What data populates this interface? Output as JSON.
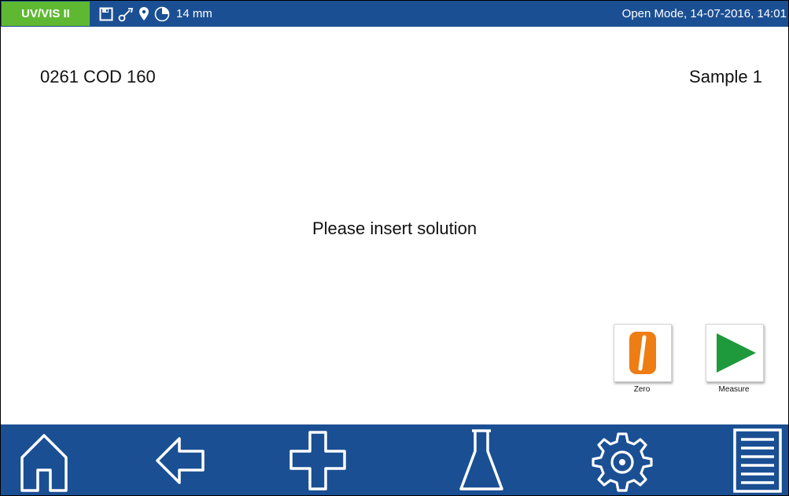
{
  "status_bar": {
    "device": "UV/VIS II",
    "cuvette": "14 mm",
    "mode_datetime": "Open Mode, 14-07-2016, 14:01",
    "icons": [
      "save-icon",
      "wrench-icon",
      "location-pin-icon",
      "pie-timer-icon"
    ],
    "colors": {
      "bar": "#1b4f93",
      "device_tag": "#5fb832"
    }
  },
  "content": {
    "test_name": "0261 COD 160",
    "sample": "Sample 1",
    "prompt": "Please insert solution"
  },
  "actions": {
    "zero": {
      "label": "Zero",
      "icon": "zero-icon",
      "color": "#ee7d14"
    },
    "measure": {
      "label": "Measure",
      "icon": "play-icon",
      "color": "#1e9a3c"
    }
  },
  "nav": [
    "home-icon",
    "back-arrow-icon",
    "plus-icon",
    "flask-icon",
    "settings-gear-icon",
    "list-icon"
  ]
}
